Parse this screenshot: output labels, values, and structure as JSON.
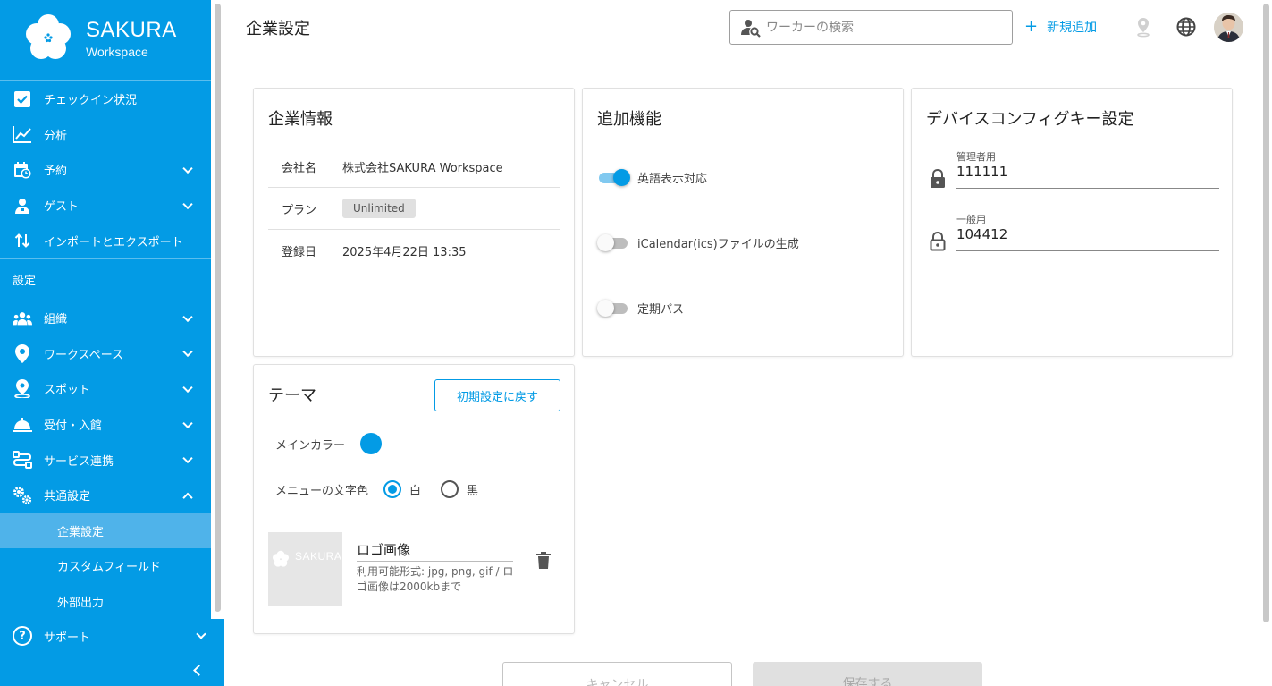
{
  "brand": {
    "name": "SAKURA",
    "sub": "Workspace"
  },
  "nav": {
    "items": [
      {
        "label": "チェックイン状況",
        "icon": "checkbox-icon",
        "chevron": false
      },
      {
        "label": "分析",
        "icon": "chart-line-icon",
        "chevron": false
      },
      {
        "label": "予約",
        "icon": "calendar-clock-icon",
        "chevron": true
      },
      {
        "label": "ゲスト",
        "icon": "guest-icon",
        "chevron": true
      },
      {
        "label": "インポートとエクスポート",
        "icon": "import-export-icon",
        "chevron": false
      }
    ],
    "section_label": "設定",
    "settings": [
      {
        "label": "組織",
        "icon": "group-icon"
      },
      {
        "label": "ワークスペース",
        "icon": "location-pin-icon"
      },
      {
        "label": "スポット",
        "icon": "spot-pin-icon"
      },
      {
        "label": "受付・入館",
        "icon": "reception-bell-icon"
      },
      {
        "label": "サービス連携",
        "icon": "integration-icon"
      },
      {
        "label": "共通設定",
        "icon": "settings-gears-icon"
      }
    ],
    "sub_items": [
      "企業設定",
      "カスタムフィールド",
      "外部出力"
    ],
    "support": "サポート"
  },
  "header": {
    "title": "企業設定",
    "search_placeholder": "ワーカーの検索",
    "add_new": "新規追加"
  },
  "company": {
    "title": "企業情報",
    "rows": [
      {
        "key": "会社名",
        "value": "株式会社SAKURA Workspace"
      },
      {
        "key": "プラン",
        "value": "Unlimited"
      },
      {
        "key": "登録日",
        "value": "2025年4月22日 13:35"
      }
    ]
  },
  "features": {
    "title": "追加機能",
    "toggles": [
      {
        "label": "英語表示対応",
        "on": true
      },
      {
        "label": "iCalendar(ics)ファイルの生成",
        "on": false
      },
      {
        "label": "定期パス",
        "on": false
      }
    ]
  },
  "device": {
    "title": "デバイスコンフィグキー設定",
    "admin_label": "管理者用",
    "admin_value": "111111",
    "general_label": "一般用",
    "general_value": "104412"
  },
  "theme": {
    "title": "テーマ",
    "reset_label": "初期設定に戻す",
    "main_color_label": "メインカラー",
    "main_color": "#039be5",
    "menu_text_color_label": "メニューの文字色",
    "option_white": "白",
    "option_black": "黒",
    "selected": "白",
    "logo_title": "ロゴ画像",
    "logo_hint": "利用可能形式: jpg, png, gif / ロゴ画像は2000kbまで",
    "logo_placeholder_text": "SAKURA"
  },
  "actions": {
    "cancel": "キャンセル",
    "save": "保存する"
  },
  "colors": {
    "primary": "#039be5",
    "sidebar_active": "#4fb3ea"
  }
}
